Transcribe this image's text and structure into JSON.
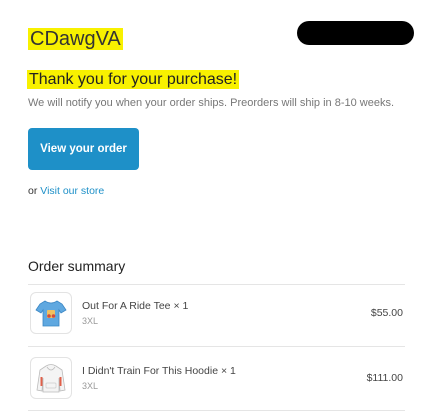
{
  "header": {
    "store_name": "CDawgVA",
    "highlight_color": "#f8f100"
  },
  "confirmation": {
    "title": "Thank you for your purchase!",
    "message": "We will notify you when your order ships. Preorders will ship in 8-10 weeks.",
    "view_order_label": "View your order",
    "or_text": "or",
    "visit_store_label": "Visit our store",
    "accent_color": "#1e90c8"
  },
  "summary": {
    "title": "Order summary",
    "items": [
      {
        "title": "Out For A Ride Tee × 1",
        "variant": "3XL",
        "price": "$55.00",
        "thumbnail_icon": "tshirt-icon"
      },
      {
        "title": "I Didn't Train For This Hoodie × 1",
        "variant": "3XL",
        "price": "$111.00",
        "thumbnail_icon": "hoodie-icon"
      }
    ]
  }
}
